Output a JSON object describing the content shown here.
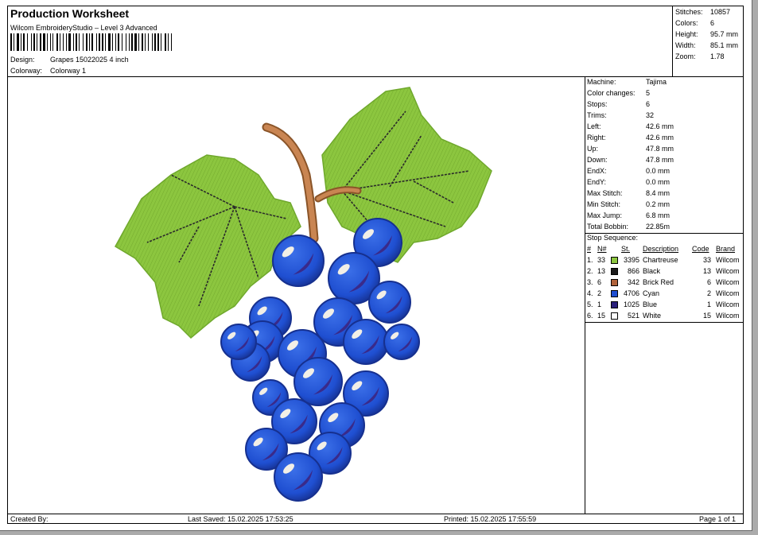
{
  "header": {
    "title": "Production Worksheet",
    "software": "Wilcom EmbroideryStudio – Level 3 Advanced",
    "design_label": "Design:",
    "design_value": "Grapes  15022025 4 inch",
    "colorway_label": "Colorway:",
    "colorway_value": "Colorway 1"
  },
  "summary": [
    {
      "label": "Stitches:",
      "value": "10857"
    },
    {
      "label": "Colors:",
      "value": "6"
    },
    {
      "label": "Height:",
      "value": "95.7 mm"
    },
    {
      "label": "Width:",
      "value": "85.1 mm"
    },
    {
      "label": "Zoom:",
      "value": "1.78"
    }
  ],
  "machine": [
    {
      "label": "Machine:",
      "value": "Tajima"
    },
    {
      "label": "Color changes:",
      "value": "5"
    },
    {
      "label": "Stops:",
      "value": "6"
    },
    {
      "label": "Trims:",
      "value": "32"
    },
    {
      "label": "Left:",
      "value": "42.6 mm"
    },
    {
      "label": "Right:",
      "value": "42.6 mm"
    },
    {
      "label": "Up:",
      "value": "47.8 mm"
    },
    {
      "label": "Down:",
      "value": "47.8 mm"
    },
    {
      "label": "EndX:",
      "value": "0.0 mm"
    },
    {
      "label": "EndY:",
      "value": "0.0 mm"
    },
    {
      "label": "Max Stitch:",
      "value": "8.4 mm"
    },
    {
      "label": "Min Stitch:",
      "value": "0.2 mm"
    },
    {
      "label": "Max Jump:",
      "value": "6.8 mm"
    },
    {
      "label": "Total Bobbin:",
      "value": "22.85m"
    }
  ],
  "stop_sequence": {
    "title": "Stop Sequence:",
    "headers": {
      "num": "#",
      "n": "N#",
      "st": "St.",
      "description": "Description",
      "code": "Code",
      "brand": "Brand"
    },
    "rows": [
      {
        "num": "1.",
        "n": "33",
        "color": "#8cc63f",
        "st": "3395",
        "description": "Chartreuse",
        "code": "33",
        "brand": "Wilcom"
      },
      {
        "num": "2.",
        "n": "13",
        "color": "#1a1a1a",
        "st": "866",
        "description": "Black",
        "code": "13",
        "brand": "Wilcom"
      },
      {
        "num": "3.",
        "n": "6",
        "color": "#b0623a",
        "st": "342",
        "description": "Brick Red",
        "code": "6",
        "brand": "Wilcom"
      },
      {
        "num": "4.",
        "n": "2",
        "color": "#1f4fd1",
        "st": "4706",
        "description": "Cyan",
        "code": "2",
        "brand": "Wilcom"
      },
      {
        "num": "5.",
        "n": "1",
        "color": "#2a1f7a",
        "st": "1025",
        "description": "Blue",
        "code": "1",
        "brand": "Wilcom"
      },
      {
        "num": "6.",
        "n": "15",
        "color": "#ffffff",
        "st": "521",
        "description": "White",
        "code": "15",
        "brand": "Wilcom"
      }
    ]
  },
  "footer": {
    "created_by": "Created By:",
    "last_saved": "Last Saved: 15.02.2025 17:53:25",
    "printed": "Printed: 15.02.2025 17:55:59",
    "page": "Page 1 of 1"
  },
  "colors": {
    "leaf": "#8cc63f",
    "leaf_dark": "#6fa82c",
    "vein": "#2a2a2a",
    "stem": "#c07a45",
    "grape": "#1f4fd1",
    "grape_dark": "#1a2f8f",
    "grape_shadow": "#3a2a8a",
    "highlight": "#f2efe6"
  }
}
